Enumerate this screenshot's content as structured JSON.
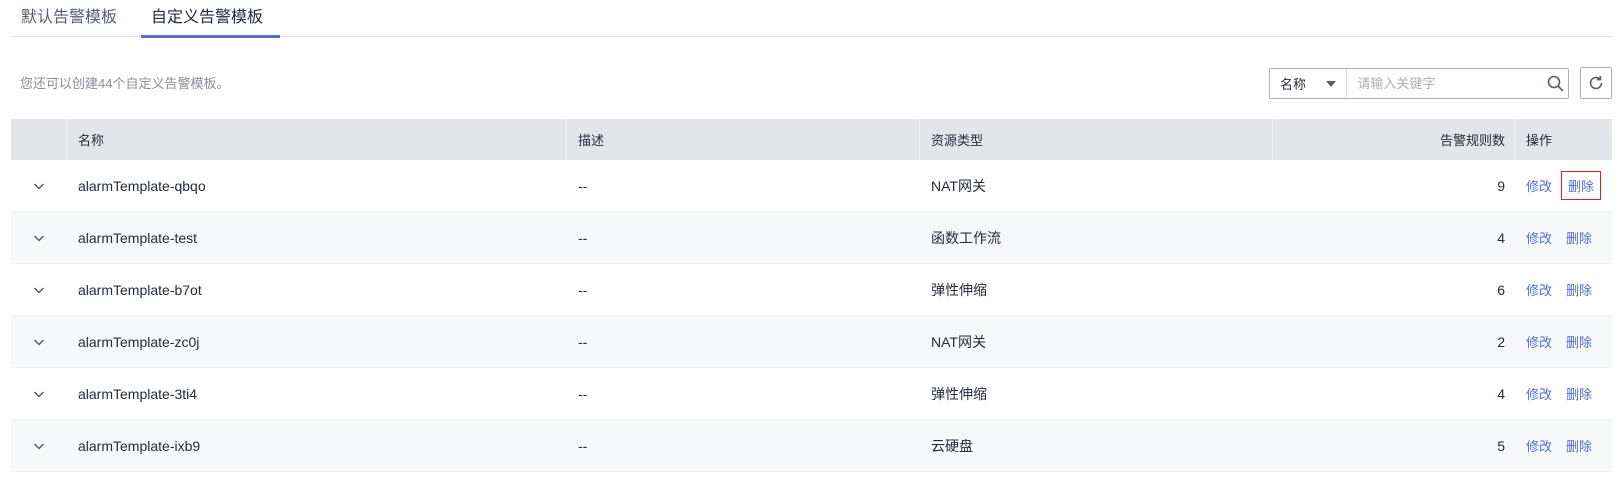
{
  "tabs": [
    {
      "label": "默认告警模板"
    },
    {
      "label": "自定义告警模板"
    }
  ],
  "hint": "您还可以创建44个自定义告警模板。",
  "search": {
    "select_value": "名称",
    "placeholder": "请输入关键字"
  },
  "table": {
    "headers": {
      "name": "名称",
      "desc": "描述",
      "resource": "资源类型",
      "rules": "告警规则数",
      "ops": "操作"
    },
    "edit_label": "修改",
    "delete_label": "删除",
    "rows": [
      {
        "name": "alarmTemplate-qbqo",
        "desc": "--",
        "resource": "NAT网关",
        "rules": "9"
      },
      {
        "name": "alarmTemplate-test",
        "desc": "--",
        "resource": "函数工作流",
        "rules": "4"
      },
      {
        "name": "alarmTemplate-b7ot",
        "desc": "--",
        "resource": "弹性伸缩",
        "rules": "6"
      },
      {
        "name": "alarmTemplate-zc0j",
        "desc": "--",
        "resource": "NAT网关",
        "rules": "2"
      },
      {
        "name": "alarmTemplate-3ti4",
        "desc": "--",
        "resource": "弹性伸缩",
        "rules": "4"
      },
      {
        "name": "alarmTemplate-ixb9",
        "desc": "--",
        "resource": "云硬盘",
        "rules": "5"
      }
    ]
  },
  "colors": {
    "accent": "#526ecc",
    "header_bg": "#e3e5e8",
    "highlight": "#e02020"
  }
}
